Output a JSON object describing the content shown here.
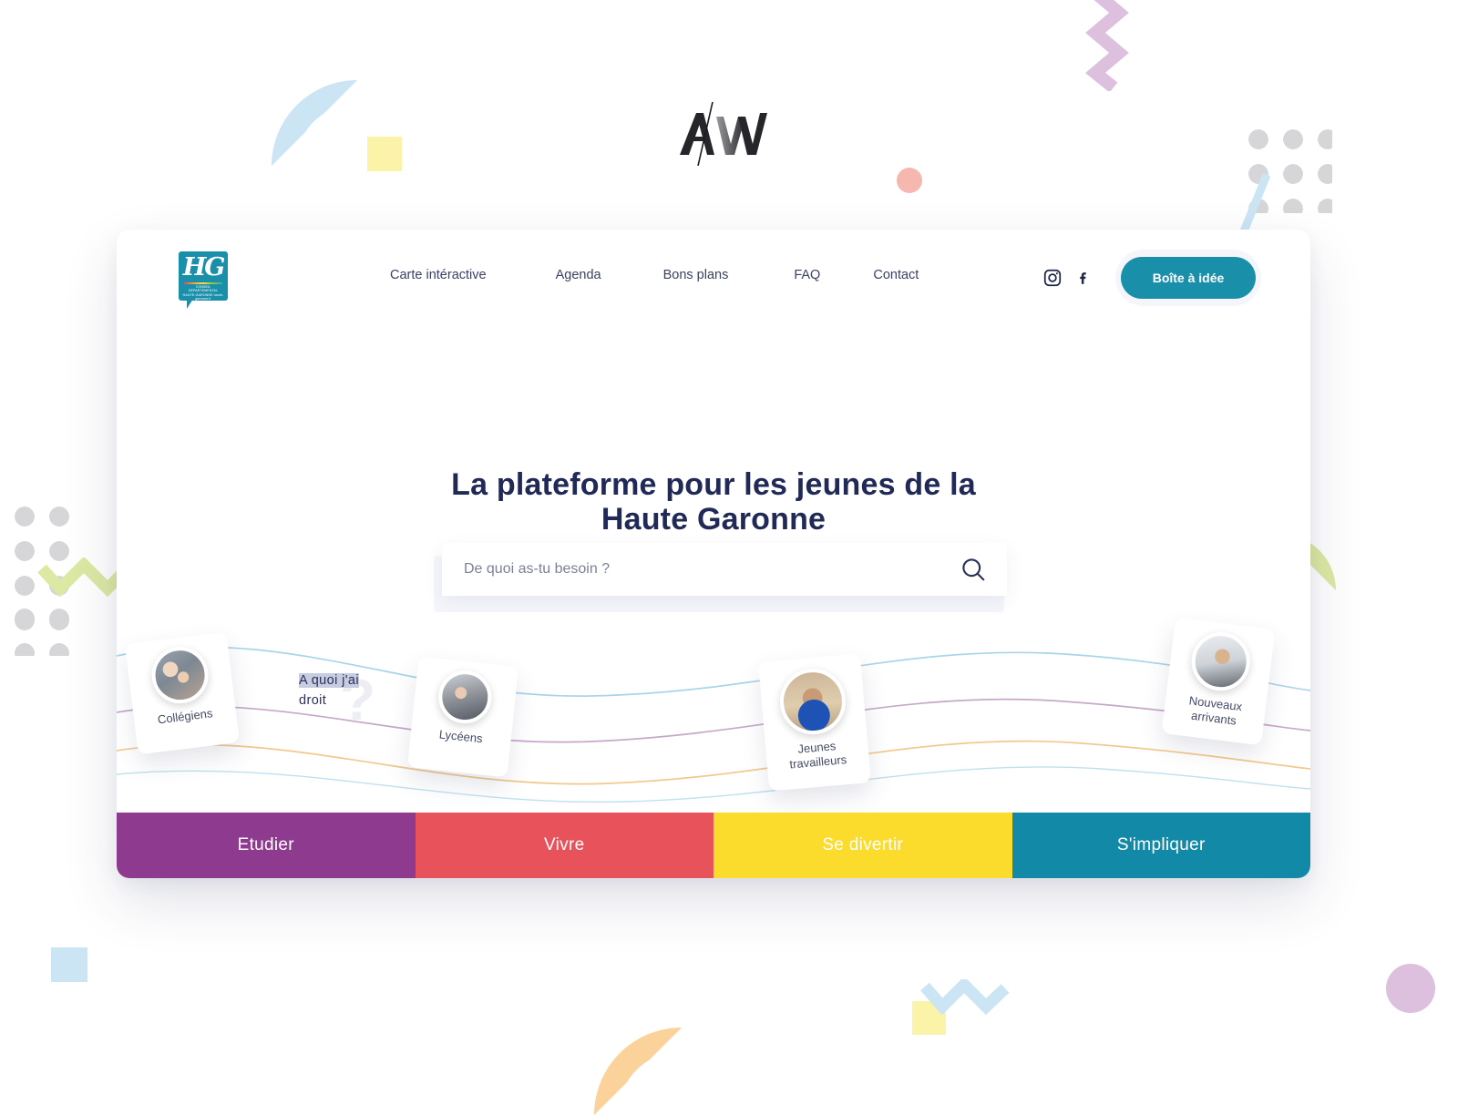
{
  "studio_logo": {
    "name": "aw-monogram",
    "alt": "AW"
  },
  "site": {
    "logo": {
      "name": "haute-garonne-logo",
      "initials": "HG",
      "subtitle": "CONSEIL DEPARTEMENTAL HAUTE-GARONNE haute-garonne.fr"
    },
    "nav": [
      {
        "label": "Carte intéractive"
      },
      {
        "label": "Agenda"
      },
      {
        "label": "Bons plans"
      },
      {
        "label": "FAQ"
      },
      {
        "label": "Contact"
      }
    ],
    "social": [
      {
        "name": "instagram-icon",
        "label": "Instagram"
      },
      {
        "name": "facebook-icon",
        "label": "Facebook"
      }
    ],
    "cta": {
      "label": "Boîte à idée"
    }
  },
  "hero": {
    "title_line1": "La plateforme pour les jeunes de la",
    "title_line2": "Haute Garonne",
    "search": {
      "placeholder": "De quoi as-tu besoin ?",
      "value": "",
      "button_icon": "search-icon"
    },
    "side_label": {
      "highlight": "A quoi j'ai",
      "rest": "droit",
      "mark": "?"
    }
  },
  "personas": [
    {
      "name": "Collégiens"
    },
    {
      "name": "Lycéens"
    },
    {
      "name": "Jeunes\ntravailleurs"
    },
    {
      "name": "Nouveaux\narrivants"
    }
  ],
  "categories": [
    {
      "label": "Etudier",
      "color": "#8E3A8E"
    },
    {
      "label": "Vivre",
      "color": "#E8525B"
    },
    {
      "label": "Se divertir",
      "color": "#FBDC2D"
    },
    {
      "label": "S'impliquer",
      "color": "#1389A8"
    }
  ],
  "palette": {
    "teal": "#1a8faa",
    "navy": "#212a56",
    "pale_blue": "#cbe5f5",
    "pale_yellow": "#fbf3a8",
    "pale_green": "#dce9a3",
    "pale_purple": "#dcc0de",
    "pale_orange": "#fbd29a",
    "salmon": "#f5b7ae",
    "dot_gray": "#d6d6d8"
  }
}
